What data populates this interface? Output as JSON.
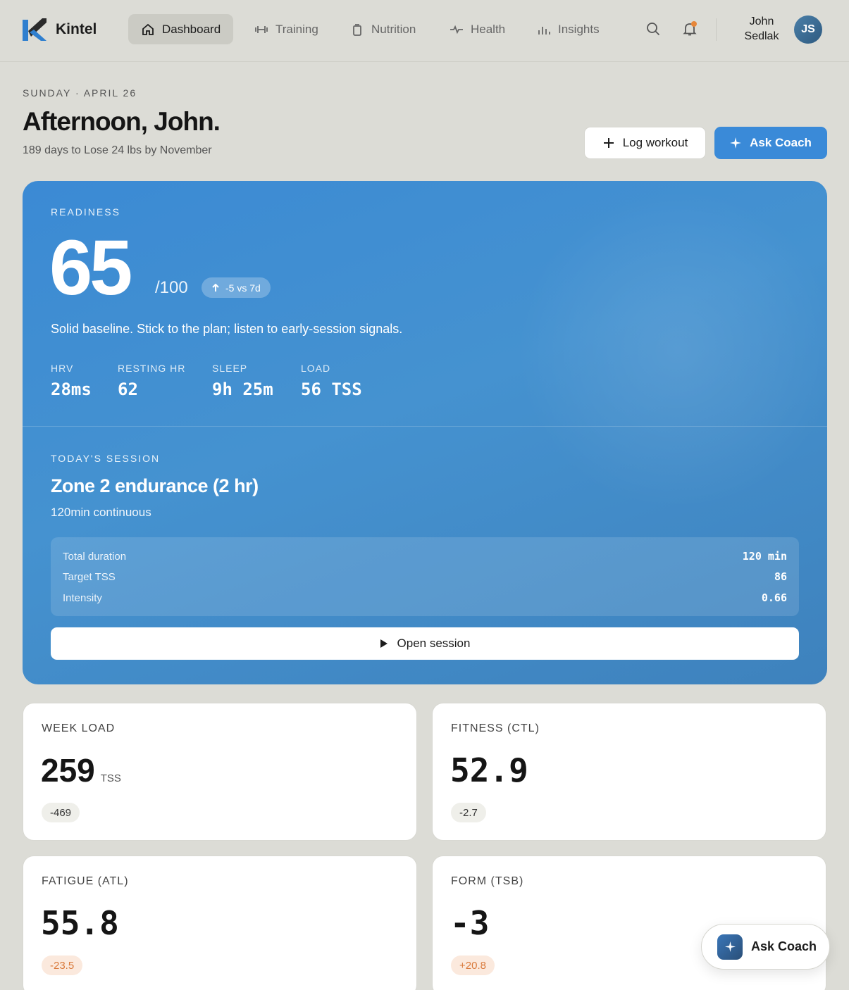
{
  "nav": {
    "brand": "Kintel",
    "items": [
      {
        "label": "Dashboard",
        "icon": "home-icon",
        "active": true
      },
      {
        "label": "Training",
        "icon": "dumbbell-icon",
        "active": false
      },
      {
        "label": "Nutrition",
        "icon": "jar-icon",
        "active": false
      },
      {
        "label": "Health",
        "icon": "pulse-icon",
        "active": false
      },
      {
        "label": "Insights",
        "icon": "bar-chart-icon",
        "active": false
      }
    ],
    "user": {
      "first": "John",
      "last": "Sedlak",
      "initials": "JS"
    },
    "has_notification": true
  },
  "header": {
    "date": "SUNDAY · APRIL 26",
    "greeting": "Afternoon, John.",
    "goal": "189 days to Lose 24 lbs by November",
    "log_label": "Log workout",
    "coach_label": "Ask Coach"
  },
  "readiness": {
    "label": "READINESS",
    "score": "65",
    "max": "/100",
    "delta": "-5 vs 7d",
    "note": "Solid baseline. Stick to the plan; listen to early-session signals.",
    "metrics": [
      {
        "label": "HRV",
        "value": "28ms"
      },
      {
        "label": "RESTING HR",
        "value": "62"
      },
      {
        "label": "SLEEP",
        "value": "9h 25m"
      },
      {
        "label": "LOAD",
        "value": "56 TSS"
      }
    ]
  },
  "session": {
    "label": "TODAY'S SESSION",
    "title": "Zone 2 endurance (2 hr)",
    "subtitle": "120min continuous",
    "rows": [
      {
        "key": "Total duration",
        "value": "120 min"
      },
      {
        "key": "Target TSS",
        "value": "86"
      },
      {
        "key": "Intensity",
        "value": "0.66"
      }
    ],
    "open_label": "Open session"
  },
  "stats": [
    {
      "label": "WEEK LOAD",
      "value": "259",
      "unit": "TSS",
      "badge": "-469",
      "tone": "neutral"
    },
    {
      "label": "FITNESS (CTL)",
      "value": "52.9",
      "unit": "",
      "badge": "-2.7",
      "tone": "neutral"
    },
    {
      "label": "FATIGUE (ATL)",
      "value": "55.8",
      "unit": "",
      "badge": "-23.5",
      "tone": "warn"
    },
    {
      "label": "FORM (TSB)",
      "value": "-3",
      "unit": "",
      "badge": "+20.8",
      "tone": "warn"
    }
  ],
  "fab": {
    "label": "Ask Coach"
  },
  "colors": {
    "accent": "#3a8ad8",
    "warn": "#d97a3c",
    "notification": "#e7873a",
    "background": "#dcdcd6"
  }
}
